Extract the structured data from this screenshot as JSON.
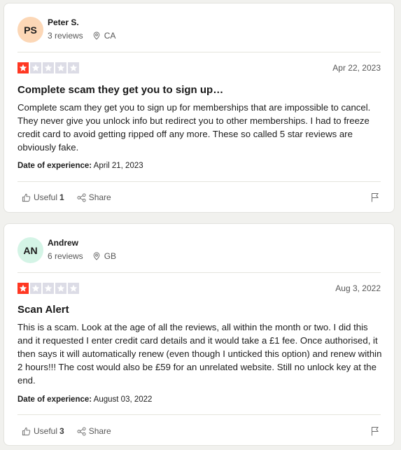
{
  "reviews": [
    {
      "initials": "PS",
      "avatar_color": "#fcd7b6",
      "name": "Peter S.",
      "review_count": "3 reviews",
      "country": "CA",
      "rating": 1,
      "date": "Apr 22, 2023",
      "title": "Complete scam they get you to sign up…",
      "body": "Complete scam they get you to sign up for memberships that are impossible to cancel. They never give you unlock info but redirect you to other memberships. I had to freeze credit card to avoid getting ripped off any more. These so called 5 star reviews are obviously fake.",
      "experience_label": "Date of experience:",
      "experience_date": "April 21, 2023",
      "useful_label": "Useful",
      "useful_count": "1",
      "share_label": "Share"
    },
    {
      "initials": "AN",
      "avatar_color": "#d4f4e6",
      "name": "Andrew",
      "review_count": "6 reviews",
      "country": "GB",
      "rating": 1,
      "date": "Aug 3, 2022",
      "title": "Scan Alert",
      "body": "This is a scam. Look at the age of all the reviews, all within the month or two. I did this and it requested I enter credit card details and it would take a £1 fee. Once authorised, it then says it will automatically renew (even though I unticked this option) and renew within 2 hours!!! The cost would also be £59 for an unrelated website. Still no unlock key at the end.",
      "experience_label": "Date of experience:",
      "experience_date": "August 03, 2022",
      "useful_label": "Useful",
      "useful_count": "3",
      "share_label": "Share"
    }
  ],
  "colors": {
    "star_filled": "#ff3722",
    "star_empty": "#dcdce6"
  }
}
